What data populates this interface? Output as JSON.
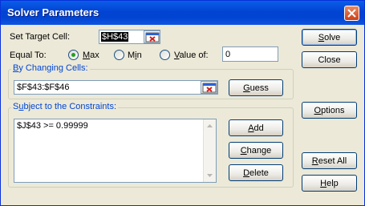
{
  "window": {
    "title": "Solver Parameters"
  },
  "target": {
    "label": "Set Target Cell:",
    "label_u": "e",
    "value": "$H$43"
  },
  "equal_to": {
    "label": "Equal To:",
    "options": [
      {
        "pre": "",
        "u": "M",
        "post": "ax",
        "checked": true
      },
      {
        "pre": "M",
        "u": "i",
        "post": "n",
        "checked": false
      },
      {
        "pre": "",
        "u": "V",
        "post": "alue of:",
        "checked": false
      }
    ],
    "value_of": "0"
  },
  "changing": {
    "label_pre": "",
    "label_u": "B",
    "label_post": "y Changing Cells:",
    "value": "$F$43:$F$46",
    "guess": {
      "pre": "",
      "u": "G",
      "post": "uess"
    }
  },
  "constraints": {
    "label_pre": "S",
    "label_u": "u",
    "label_post": "bject to the Constraints:",
    "items": [
      "$J$43 >= 0.99999"
    ],
    "add": {
      "pre": "",
      "u": "A",
      "post": "dd"
    },
    "change": {
      "pre": "",
      "u": "C",
      "post": "hange"
    },
    "delete": {
      "pre": "",
      "u": "D",
      "post": "elete"
    }
  },
  "buttons": {
    "solve": {
      "pre": "",
      "u": "S",
      "post": "olve"
    },
    "close": "Close",
    "options": {
      "pre": "",
      "u": "O",
      "post": "ptions"
    },
    "reset": {
      "pre": "",
      "u": "R",
      "post": "eset All"
    },
    "help": {
      "pre": "",
      "u": "H",
      "post": "elp"
    }
  }
}
